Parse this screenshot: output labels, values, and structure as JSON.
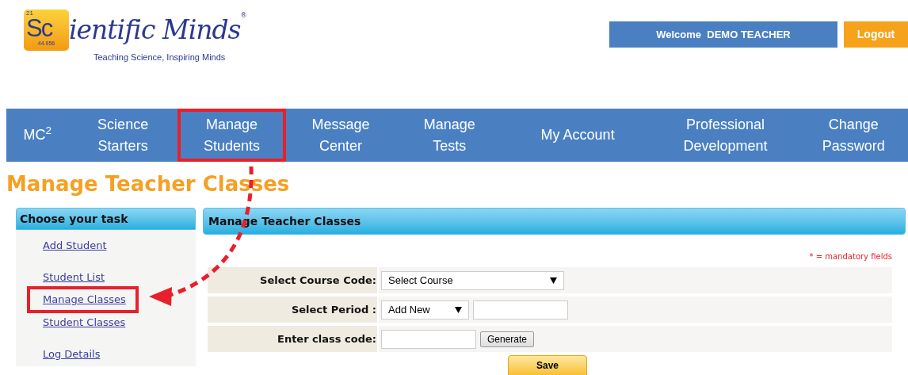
{
  "logo": {
    "atomic_number": "21",
    "symbol": "Sc",
    "mass": "44.956",
    "wordmark": "ientific Minds",
    "registered": "®",
    "tagline": "Teaching Science, Inspiring Minds"
  },
  "header": {
    "welcome": "Welcome  DEMO TEACHER",
    "logout": "Logout"
  },
  "nav": [
    {
      "label": "MC$^{2}$",
      "highlighted": false
    },
    {
      "label": "Science\nStarters",
      "highlighted": false
    },
    {
      "label": "Manage\nStudents",
      "highlighted": true
    },
    {
      "label": "Message\nCenter",
      "highlighted": false
    },
    {
      "label": "Manage\nTests",
      "highlighted": false
    },
    {
      "label": "My Account",
      "highlighted": false
    },
    {
      "label": "Professional\nDevelopment",
      "highlighted": false
    },
    {
      "label": "Change\nPassword",
      "highlighted": false
    }
  ],
  "page_title": "Manage Teacher Classes",
  "sidebar": {
    "title": "Choose your task",
    "items": [
      {
        "label": "Add Student",
        "highlighted": false
      },
      {
        "label": "Student List",
        "highlighted": false
      },
      {
        "label": "Manage Classes",
        "highlighted": true
      },
      {
        "label": "Student Classes",
        "highlighted": false
      },
      {
        "label": "Log Details",
        "highlighted": false
      }
    ]
  },
  "panel": {
    "title": "Manage Teacher Classes",
    "note": "* = mandatory fields",
    "rows": [
      {
        "label": "Select Course Code:",
        "kind": "select",
        "select": "Select Course"
      },
      {
        "label": "Select Period :",
        "kind": "select_input",
        "select": "Add New"
      },
      {
        "label": "Enter class code:",
        "kind": "input_button",
        "button": "Generate"
      }
    ],
    "save": "Save"
  }
}
